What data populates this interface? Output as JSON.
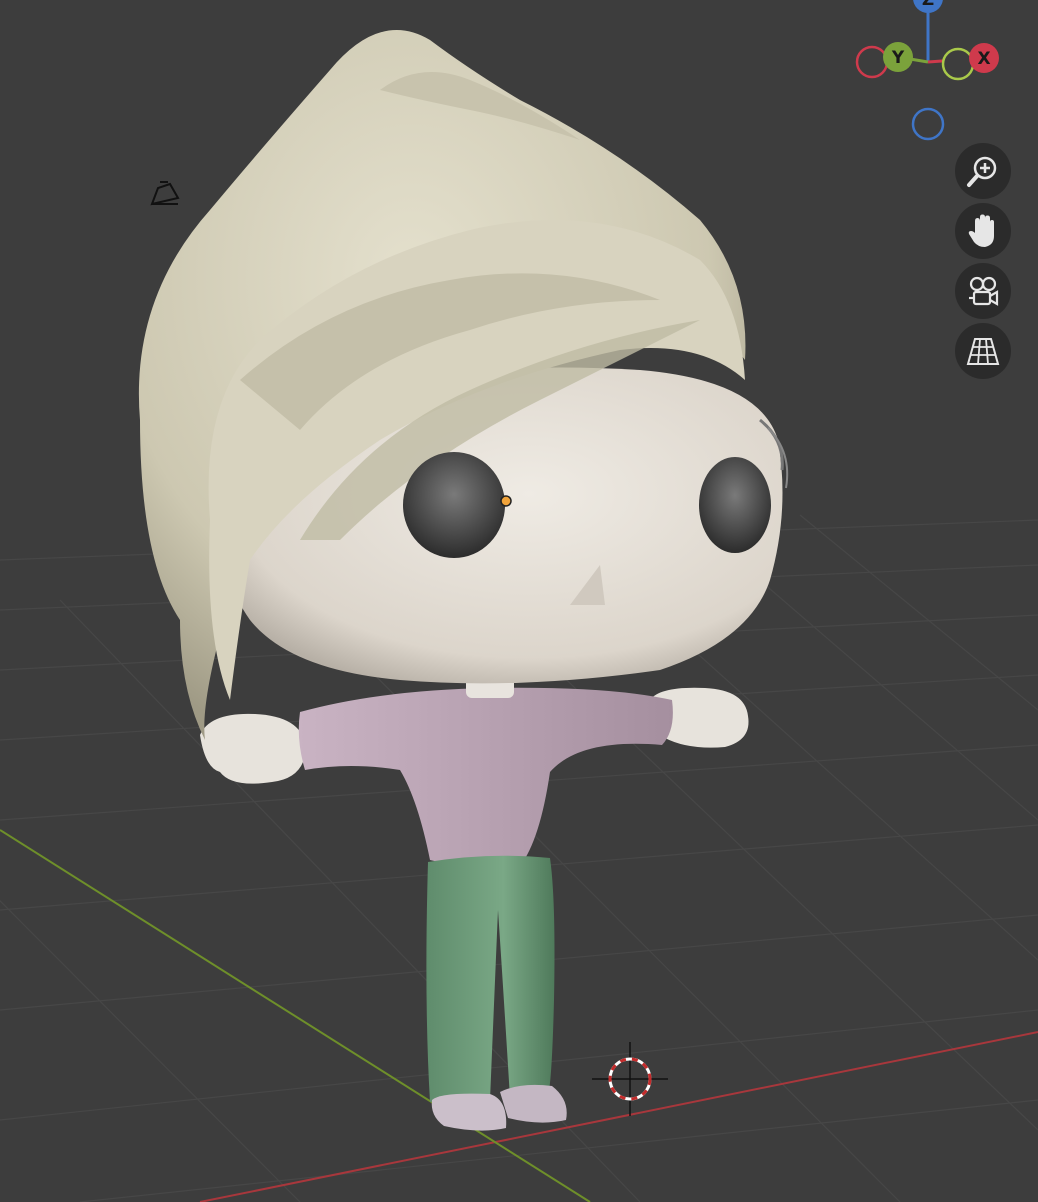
{
  "app": "3D viewport",
  "gizmo": {
    "x_label": "X",
    "y_label": "Y",
    "z_label": "Z",
    "x_color": "#cf3a4c",
    "y_color": "#7ba23b",
    "z_color": "#3f75c7"
  },
  "nav_buttons": [
    {
      "name": "zoom",
      "icon": "zoom-in-icon"
    },
    {
      "name": "pan",
      "icon": "hand-icon"
    },
    {
      "name": "camera-view",
      "icon": "camera-icon"
    },
    {
      "name": "perspective-toggle",
      "icon": "grid-perspective-icon"
    }
  ],
  "scene_objects": {
    "light": "light-icon",
    "cursor": "3d-cursor",
    "character": "character-model"
  },
  "colors": {
    "background": "#3d3d3d",
    "grid_line": "#474747",
    "axis_x": "#a8373c",
    "axis_y": "#6e8f2a",
    "hair": "#d4d0bc",
    "skin": "#e6e1da",
    "shirt": "#b9a3b3",
    "pants": "#6b9877",
    "shoes": "#cbbfca"
  }
}
